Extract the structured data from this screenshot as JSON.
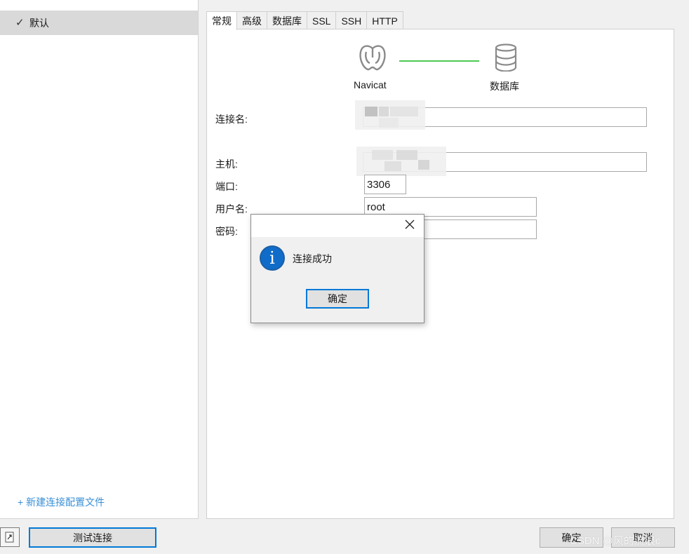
{
  "sidebar": {
    "profiles": [
      {
        "label": "默认",
        "selected": true
      }
    ],
    "new_profile_label": "+ 新建连接配置文件"
  },
  "tabs": [
    {
      "label": "常规",
      "active": true
    },
    {
      "label": "高级",
      "active": false
    },
    {
      "label": "数据库",
      "active": false
    },
    {
      "label": "SSL",
      "active": false
    },
    {
      "label": "SSH",
      "active": false
    },
    {
      "label": "HTTP",
      "active": false
    }
  ],
  "graphic": {
    "client_label": "Navicat",
    "server_label": "数据库",
    "line_color": "#4cc952"
  },
  "form": {
    "connection_name": {
      "label": "连接名:",
      "value": ""
    },
    "host": {
      "label": "主机:",
      "value": ""
    },
    "port": {
      "label": "端口:",
      "value": "3306"
    },
    "username": {
      "label": "用户名:",
      "value": "root"
    },
    "password": {
      "label": "密码:",
      "value": ""
    }
  },
  "buttons": {
    "test_connection": "测试连接",
    "ok": "确定",
    "cancel": "取消"
  },
  "dialog": {
    "message": "连接成功",
    "ok_label": "确定",
    "icon": "info-icon"
  },
  "watermark": "CSDN @风的流浪c",
  "colors": {
    "accent": "#0078d7",
    "link": "#3a8fd6",
    "info_icon": "#0f6cc9"
  }
}
